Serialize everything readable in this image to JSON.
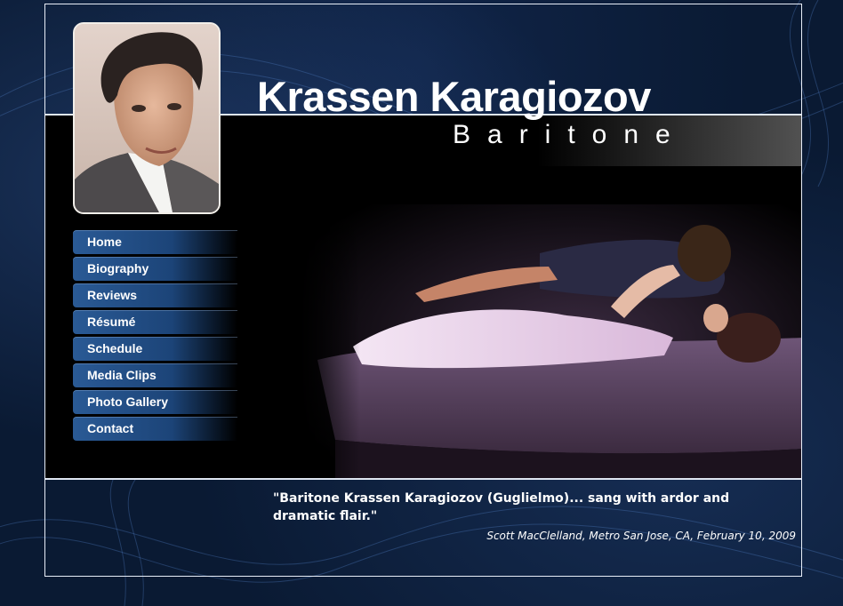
{
  "header": {
    "name": "Krassen Karagiozov",
    "role": "Baritone"
  },
  "portrait": {
    "icon": "portrait-photo"
  },
  "nav": {
    "items": [
      {
        "label": "Home"
      },
      {
        "label": "Biography"
      },
      {
        "label": "Reviews"
      },
      {
        "label": "Résumé"
      },
      {
        "label": "Schedule"
      },
      {
        "label": "Media Clips"
      },
      {
        "label": "Photo Gallery"
      },
      {
        "label": "Contact"
      }
    ]
  },
  "feature": {
    "icon": "stage-scene-photo"
  },
  "review": {
    "quote": "\"Baritone Krassen Karagiozov (Guglielmo)... sang with ardor and dramatic flair.\"",
    "attribution": "Scott MacClelland, Metro San Jose, CA, February 10, 2009"
  },
  "colors": {
    "background": "#0a1a33",
    "panel": "#000000",
    "nav": "#1c4478",
    "text": "#ffffff"
  }
}
